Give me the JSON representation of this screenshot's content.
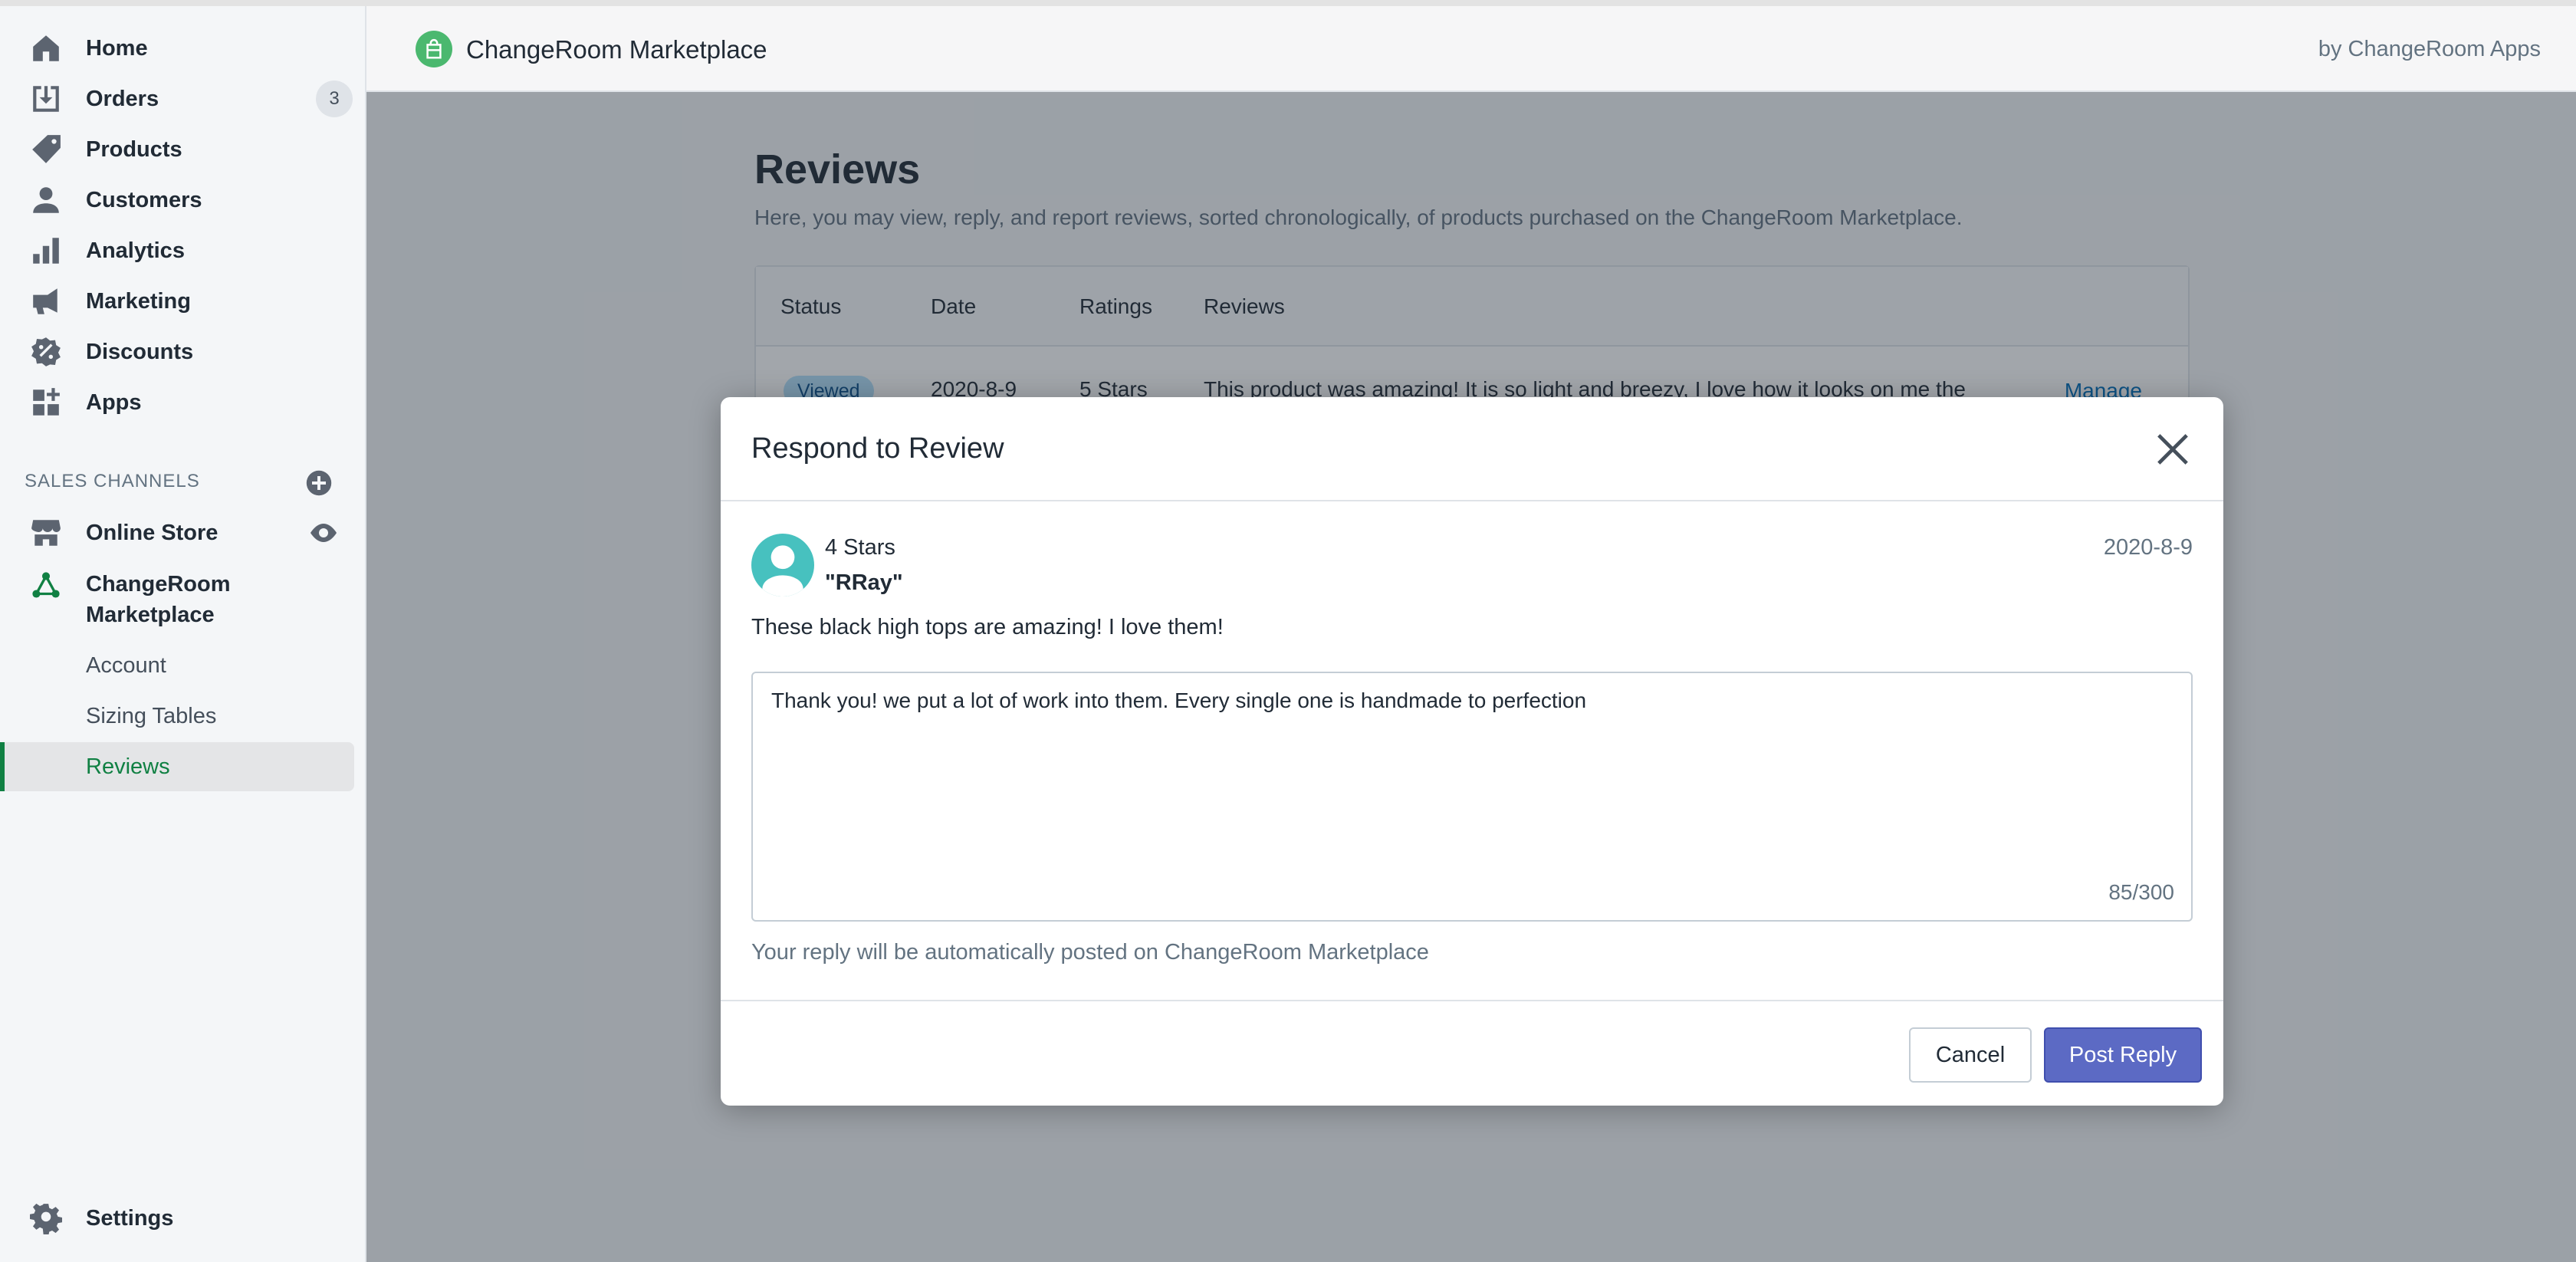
{
  "sidebar": {
    "items": [
      {
        "label": "Home",
        "icon": "home-icon"
      },
      {
        "label": "Orders",
        "icon": "orders-icon",
        "badge": "3"
      },
      {
        "label": "Products",
        "icon": "tag-icon"
      },
      {
        "label": "Customers",
        "icon": "person-icon"
      },
      {
        "label": "Analytics",
        "icon": "bar-chart-icon"
      },
      {
        "label": "Marketing",
        "icon": "megaphone-icon"
      },
      {
        "label": "Discounts",
        "icon": "discount-icon"
      },
      {
        "label": "Apps",
        "icon": "apps-icon"
      }
    ],
    "sales_channels_heading": "SALES CHANNELS",
    "channels": [
      {
        "label": "Online Store",
        "icon": "store-icon"
      },
      {
        "label": "ChangeRoom\nMarketplace",
        "icon": "nodes-icon"
      }
    ],
    "sub_items": [
      {
        "label": "Account"
      },
      {
        "label": "Sizing Tables"
      },
      {
        "label": "Reviews",
        "active": true
      }
    ],
    "settings_label": "Settings"
  },
  "topbar": {
    "app_title": "ChangeRoom Marketplace",
    "by_text": "by ChangeRoom Apps"
  },
  "page": {
    "title": "Reviews",
    "description": "Here, you may view, reply, and report reviews, sorted chronologically, of products purchased on the ChangeRoom Marketplace.",
    "table": {
      "headers": [
        "Status",
        "Date",
        "Ratings",
        "Reviews"
      ],
      "row": {
        "status": "Viewed",
        "date": "2020-8-9",
        "rating": "5 Stars",
        "review": "This product was amazing! It is so light and breezy, I love how it looks on me the",
        "action": "Manage"
      }
    }
  },
  "modal": {
    "title": "Respond to Review",
    "rating": "4 Stars",
    "reviewer": "\"RRay\"",
    "date": "2020-8-9",
    "review_text": "These black high tops are amazing! I love them!",
    "reply_value": "Thank you! we put a lot of work into them. Every single one is handmade to perfection",
    "char_count": "85/300",
    "help_text": "Your reply will be automatically posted on ChangeRoom Marketplace",
    "cancel_label": "Cancel",
    "post_label": "Post Reply"
  },
  "colors": {
    "accent": "#5c6ac4",
    "active_green": "#108043",
    "app_logo": "#4bb86f",
    "avatar": "#47c1bf",
    "status_viewed": "#b4e1fa"
  }
}
